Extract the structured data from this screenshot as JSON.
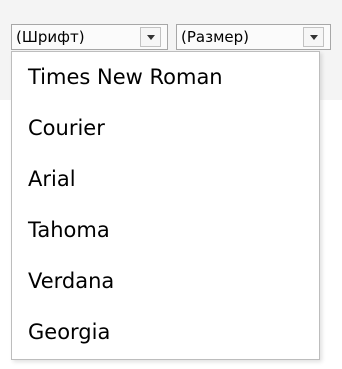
{
  "toolbar": {
    "font_select": {
      "value": "(Шрифт)",
      "expanded": true
    },
    "size_select": {
      "value": "(Размер)",
      "expanded": false
    }
  },
  "font_dropdown": {
    "options": [
      "Times New Roman",
      "Courier",
      "Arial",
      "Tahoma",
      "Verdana",
      "Georgia"
    ]
  },
  "icons": {
    "dropdown_arrow": "chevron-down-icon"
  },
  "colors": {
    "border": "#a7a7a7",
    "toolbar_background": "#f4f4f4",
    "dropdown_background": "#ffffff",
    "text": "#000000"
  }
}
